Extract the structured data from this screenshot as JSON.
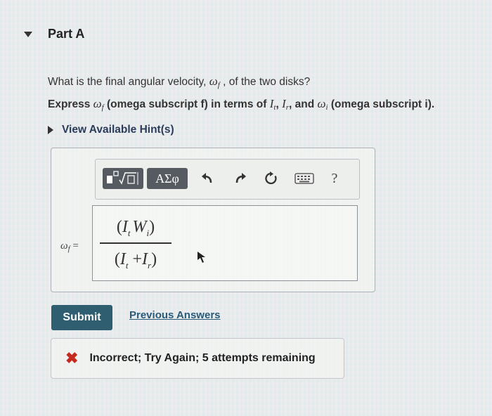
{
  "part": {
    "title": "Part A"
  },
  "question": {
    "text_before": "What is the final angular velocity, ",
    "omega_symbol": "ω",
    "omega_sub_f": "f",
    "text_after": " , of the two disks?"
  },
  "instruction": {
    "express": "Express ",
    "omega_symbol": "ω",
    "omega_sub_f": "f",
    "mid1": " (omega subscript f) in terms of ",
    "I_symbol": "I",
    "I_sub_t": "t",
    "comma": ", ",
    "I_sub_r": "r",
    "and": ", and ",
    "omega_sub_i": "i",
    "tail": " (omega subscript i)."
  },
  "hint": {
    "label": "View Available Hint(s)"
  },
  "toolbar": {
    "symbols_label": "ΑΣφ",
    "help_label": "?",
    "icons": [
      "templates-icon",
      "undo-icon",
      "redo-icon",
      "reset-icon",
      "keyboard-icon",
      "help-icon"
    ]
  },
  "answer": {
    "lhs_omega": "ω",
    "lhs_sub": "f",
    "equals": " =",
    "num_open": "(",
    "num_I": "I",
    "num_I_sub": "t",
    "num_W": "W",
    "num_W_sub": "i",
    "num_close": ")",
    "den_open": "(",
    "den_I1": "I",
    "den_I1_sub": "t",
    "den_plus": " +",
    "den_I2": "I",
    "den_I2_sub": "r",
    "den_close": ")"
  },
  "actions": {
    "submit_label": "Submit",
    "previous_answers_label": "Previous Answers"
  },
  "feedback": {
    "icon": "incorrect-x-icon",
    "message": "Incorrect; Try Again; 5 attempts remaining",
    "color": "#c42a1e"
  }
}
